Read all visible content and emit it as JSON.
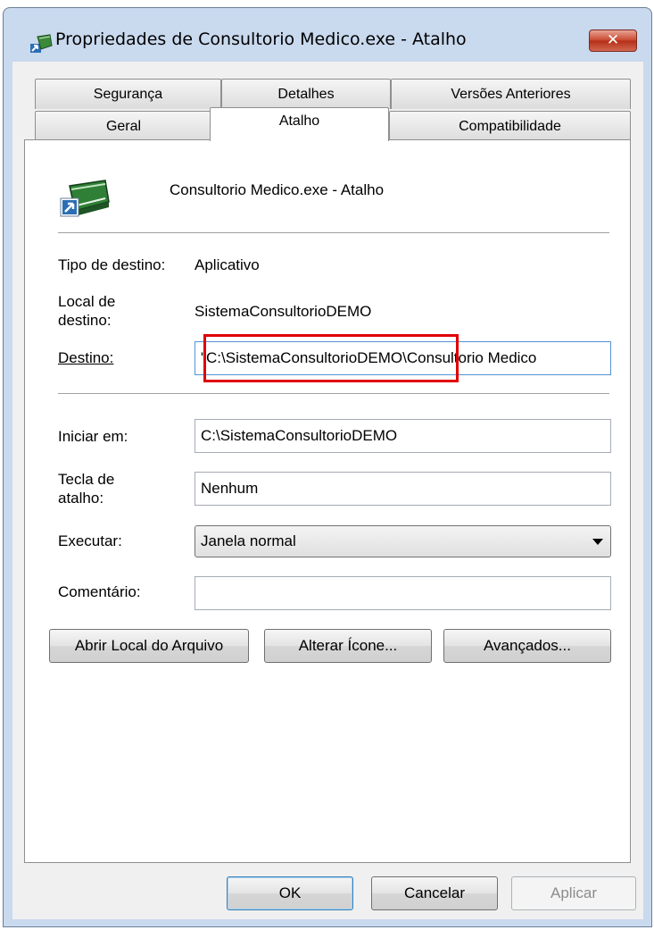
{
  "window": {
    "title": "Propriedades de Consultorio Medico.exe - Atalho",
    "close_label": "✕"
  },
  "tabs": {
    "row1": [
      "Segurança",
      "Detalhes",
      "Versões Anteriores"
    ],
    "row2": [
      "Geral",
      "Atalho",
      "Compatibilidade"
    ],
    "active": "Atalho"
  },
  "shortcut": {
    "name": "Consultorio Medico.exe - Atalho",
    "target_type_label": "Tipo de destino:",
    "target_type_value": "Aplicativo",
    "target_location_label_1": "Local de",
    "target_location_label_2": "destino:",
    "target_location_value": "SistemaConsultorioDEMO",
    "target_label": "Destino:",
    "target_value": "\"C:\\SistemaConsultorioDEMO\\Consultorio Medico",
    "start_in_label": "Iniciar em:",
    "start_in_value": "C:\\SistemaConsultorioDEMO",
    "hotkey_label_1": "Tecla de",
    "hotkey_label_2": "atalho:",
    "hotkey_value": "Nenhum",
    "run_label": "Executar:",
    "run_value": "Janela normal",
    "comment_label": "Comentário:",
    "comment_value": ""
  },
  "buttons": {
    "open_location": "Abrir Local do Arquivo",
    "change_icon": "Alterar Ícone...",
    "advanced": "Avançados...",
    "ok": "OK",
    "cancel": "Cancelar",
    "apply": "Aplicar"
  },
  "colors": {
    "highlight_box": "#e00000",
    "close_button": "#c8452d"
  }
}
